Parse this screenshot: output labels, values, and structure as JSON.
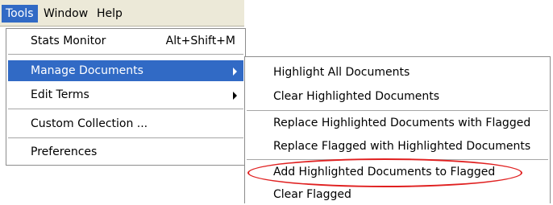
{
  "menubar": {
    "items": [
      {
        "label": "Tools",
        "active": true
      },
      {
        "label": "Window",
        "active": false
      },
      {
        "label": "Help",
        "active": false
      }
    ]
  },
  "tools_menu": {
    "items": [
      {
        "label": "Stats Monitor",
        "shortcut": "Alt+Shift+M"
      },
      {
        "label": "Manage Documents",
        "submenu": true,
        "highlighted": true
      },
      {
        "label": "Edit Terms",
        "submenu": true
      },
      {
        "label": "Custom Collection ..."
      },
      {
        "label": "Preferences"
      }
    ]
  },
  "manage_documents_submenu": {
    "items": [
      {
        "label": "Highlight All Documents"
      },
      {
        "label": "Clear Highlighted Documents"
      },
      {
        "label": "Replace Highlighted Documents with Flagged"
      },
      {
        "label": "Replace Flagged with Highlighted Documents"
      },
      {
        "label": "Add Highlighted Documents to Flagged",
        "circled": true
      },
      {
        "label": "Clear Flagged"
      }
    ]
  },
  "colors": {
    "highlight": "#316ac5",
    "menubar_bg": "#ece9d8",
    "callout": "#e02020"
  }
}
